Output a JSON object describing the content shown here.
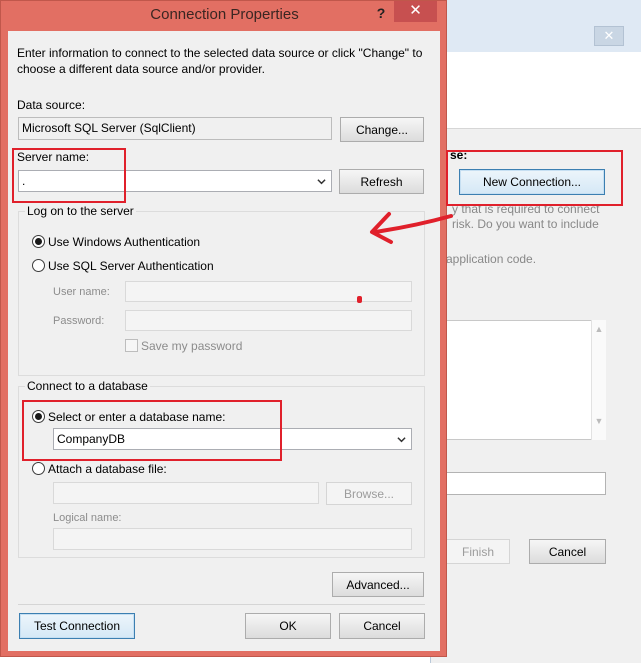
{
  "dialog": {
    "title": "Connection Properties",
    "help_glyph": "?",
    "close_glyph": "✕",
    "intro": "Enter information to connect to the selected data source or click \"Change\" to choose a different data source and/or provider.",
    "data_source": {
      "label": "Data source:",
      "value": "Microsoft SQL Server (SqlClient)",
      "change_button": "Change..."
    },
    "server": {
      "label": "Server name:",
      "value": ".",
      "refresh_button": "Refresh"
    },
    "logon": {
      "group_title": "Log on to the server",
      "windows_auth": "Use Windows Authentication",
      "sql_auth": "Use SQL Server Authentication",
      "selected": "windows",
      "user_name_label": "User name:",
      "password_label": "Password:",
      "save_password": "Save my password"
    },
    "database": {
      "group_title": "Connect to a database",
      "select_option": "Select or enter a database name:",
      "database_name": "CompanyDB",
      "attach_option": "Attach a database file:",
      "browse_button": "Browse...",
      "logical_name_label": "Logical name:",
      "selected": "select"
    },
    "advanced_button": "Advanced...",
    "test_connection_button": "Test Connection",
    "ok_button": "OK",
    "cancel_button": "Cancel"
  },
  "background_dialog": {
    "close_glyph": "✕",
    "text_fragment_1": "se:",
    "new_connection_button": "New Connection...",
    "text_fragment_2": "y that is required to connect",
    "text_fragment_3": "risk. Do you want to include",
    "text_fragment_4": "application code.",
    "finish_button": "Finish",
    "cancel_button": "Cancel"
  },
  "colors": {
    "dialog_frame": "#e26f63",
    "annotation_red": "#e0202b",
    "close_button": "#c75050"
  }
}
